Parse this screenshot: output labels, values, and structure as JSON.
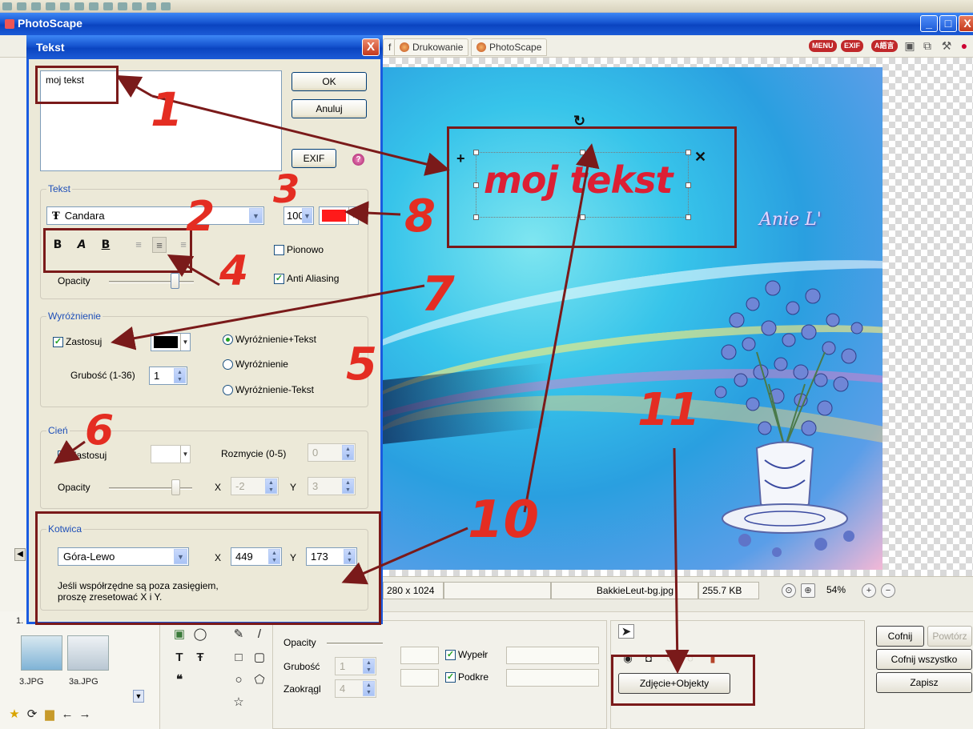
{
  "app": {
    "title": "PhotoScape",
    "tabs": [
      {
        "label": "f"
      },
      {
        "label": "Drukowanie"
      },
      {
        "label": "PhotoScape"
      }
    ],
    "badges": [
      "MENU",
      "EXIF",
      "A語言"
    ],
    "win_buttons": [
      "_",
      "□",
      "X"
    ]
  },
  "dialog": {
    "title": "Tekst",
    "close": "X",
    "text_value": "moj tekst",
    "ok": "OK",
    "cancel": "Anuluj",
    "exif": "EXIF",
    "help": "?",
    "text_group": {
      "label": "Tekst",
      "font": "Candara",
      "font_glyph": "Ŧ",
      "size": "100",
      "color": "#ff1a1a",
      "format_buttons": [
        "B",
        "A",
        "B"
      ],
      "align_buttons": [
        "≡",
        "≡",
        "≡"
      ],
      "vertical_label": "Pionowo",
      "vertical_checked": false,
      "antialias_label": "Anti Aliasing",
      "antialias_checked": true,
      "opacity_label": "Opacity",
      "opacity_level": 0.8
    },
    "highlight_group": {
      "label": "Wyróżnienie",
      "apply_label": "Zastosuj",
      "apply_checked": true,
      "color": "#000000",
      "thickness_label": "Grubość (1-36)",
      "thickness_value": "1",
      "options": [
        "Wyróżnienie+Tekst",
        "Wyróżnienie",
        "Wyróżnienie-Tekst"
      ],
      "selected": "Wyróżnienie+Tekst"
    },
    "shadow_group": {
      "label": "Cień",
      "apply_label": "Zastosuj",
      "apply_checked": false,
      "blur_label": "Rozmycie (0-5)",
      "blur_value": "0",
      "opacity_label": "Opacity",
      "x_label": "X",
      "x_value": "-2",
      "y_label": "Y",
      "y_value": "3"
    },
    "anchor_group": {
      "label": "Kotwica",
      "position": "Góra-Lewo",
      "x_label": "X",
      "x_value": "449",
      "y_label": "Y",
      "y_value": "173",
      "note_line1": "Jeśli współrzędne są poza zasięgiem,",
      "note_line2": "proszę zresetować X i Y."
    }
  },
  "canvas": {
    "text": "moj tekst",
    "signature": "Anie L'",
    "rotate_handle": "↻",
    "move_handle": "+",
    "delete_handle": "✕"
  },
  "statusbar": {
    "dimensions": "280 x 1024",
    "filename": "BakkieLeut-bg.jpg",
    "filesize": "255.7 KB",
    "zoom": "54%"
  },
  "thumbnails": [
    {
      "label": "1."
    },
    {
      "label": "3.JPG"
    },
    {
      "label": "3a.JPG"
    }
  ],
  "tools": {
    "opacity_label": "Opacity",
    "thickness_label": "Grubość",
    "thickness_value": "1",
    "rounding_label": "Zaokrągl",
    "rounding_value": "4",
    "fill_label": "Wypełr",
    "outline_label": "Podkre",
    "photo_objects_button": "Zdjęcie+Objekty",
    "undo_button": "Cofnij",
    "redo_button": "Powtórz",
    "undo_all_button": "Cofnij wszystko",
    "save_button": "Zapisz"
  },
  "annotations": {
    "numbers": [
      "1",
      "2",
      "3",
      "4",
      "5",
      "6",
      "7",
      "8",
      "10",
      "11"
    ],
    "color": "#e42d22",
    "box_color": "#7a1a1a"
  }
}
